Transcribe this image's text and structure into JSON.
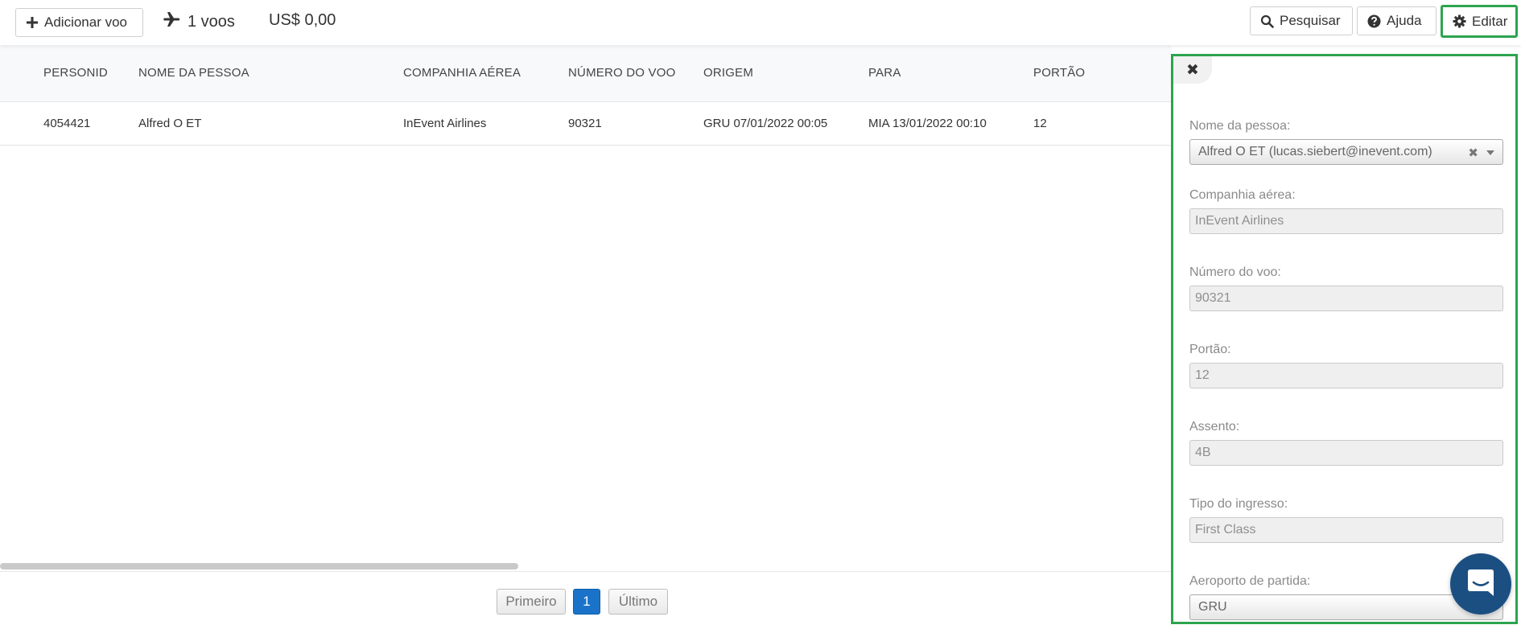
{
  "toolbar": {
    "add_flight_label": "Adicionar voo",
    "flights_count": "1 voos",
    "total_cost": "US$ 0,00",
    "search_label": "Pesquisar",
    "help_label": "Ajuda",
    "edit_label": "Editar"
  },
  "table": {
    "headers": [
      "PERSONID",
      "NOME DA PESSOA",
      "COMPANHIA AÉREA",
      "NÚMERO DO VOO",
      "ORIGEM",
      "PARA",
      "PORTÃO"
    ],
    "rows": [
      [
        "4054421",
        "Alfred O ET",
        "InEvent Airlines",
        "90321",
        "GRU 07/01/2022 00:05",
        "MIA 13/01/2022 00:10",
        "12"
      ]
    ]
  },
  "pagination": {
    "first": "Primeiro",
    "current": "1",
    "last": "Último"
  },
  "panel": {
    "close_symbol": "✖",
    "fields": [
      {
        "label": "Nome da pessoa:",
        "value": "Alfred O ET (lucas.siebert@inevent.com)",
        "clear": "✖"
      },
      {
        "label": "Companhia aérea:",
        "value": "InEvent Airlines"
      },
      {
        "label": "Número do voo:",
        "value": "90321"
      },
      {
        "label": "Portão:",
        "value": "12"
      },
      {
        "label": "Assento:",
        "value": "4B"
      },
      {
        "label": "Tipo do ingresso:",
        "value": "First Class"
      },
      {
        "label": "Aeroporto de partida:",
        "value": "GRU"
      }
    ]
  },
  "colors": {
    "highlight": "#2da44e",
    "active_page": "#1a73c8",
    "chat_button": "#1b4f82"
  },
  "icons": [
    "plus-icon",
    "plane-icon",
    "search-icon",
    "question-circle-icon",
    "gear-icon",
    "close-icon",
    "chat-icon"
  ]
}
